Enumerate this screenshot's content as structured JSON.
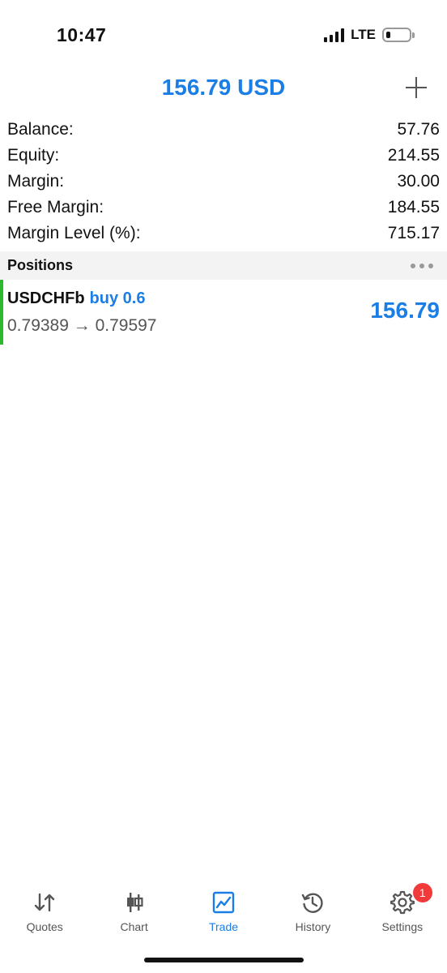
{
  "status_bar": {
    "time": "10:47",
    "network": "LTE"
  },
  "header": {
    "title": "156.79 USD",
    "add_icon": "plus-icon"
  },
  "summary": [
    {
      "label": "Balance:",
      "value": "57.76"
    },
    {
      "label": "Equity:",
      "value": "214.55"
    },
    {
      "label": "Margin:",
      "value": "30.00"
    },
    {
      "label": "Free Margin:",
      "value": "184.55"
    },
    {
      "label": "Margin Level (%):",
      "value": "715.17"
    }
  ],
  "positions": {
    "title": "Positions",
    "items": [
      {
        "symbol": "USDCHFb",
        "side": "buy 0.6",
        "prices": "0.79389 → 0.79597",
        "profit": "156.79",
        "accent_color": "#2eb82e"
      }
    ]
  },
  "tabs": [
    {
      "label": "Quotes",
      "icon": "quotes-arrows-icon",
      "active": false
    },
    {
      "label": "Chart",
      "icon": "candlestick-chart-icon",
      "active": false
    },
    {
      "label": "Trade",
      "icon": "trade-chart-icon",
      "active": true
    },
    {
      "label": "History",
      "icon": "history-clock-icon",
      "active": false
    },
    {
      "label": "Settings",
      "icon": "gear-icon",
      "active": false,
      "badge": "1"
    }
  ],
  "colors": {
    "accent": "#1a7ee6",
    "positive": "#2eb82e",
    "badge": "#f23a3a"
  }
}
